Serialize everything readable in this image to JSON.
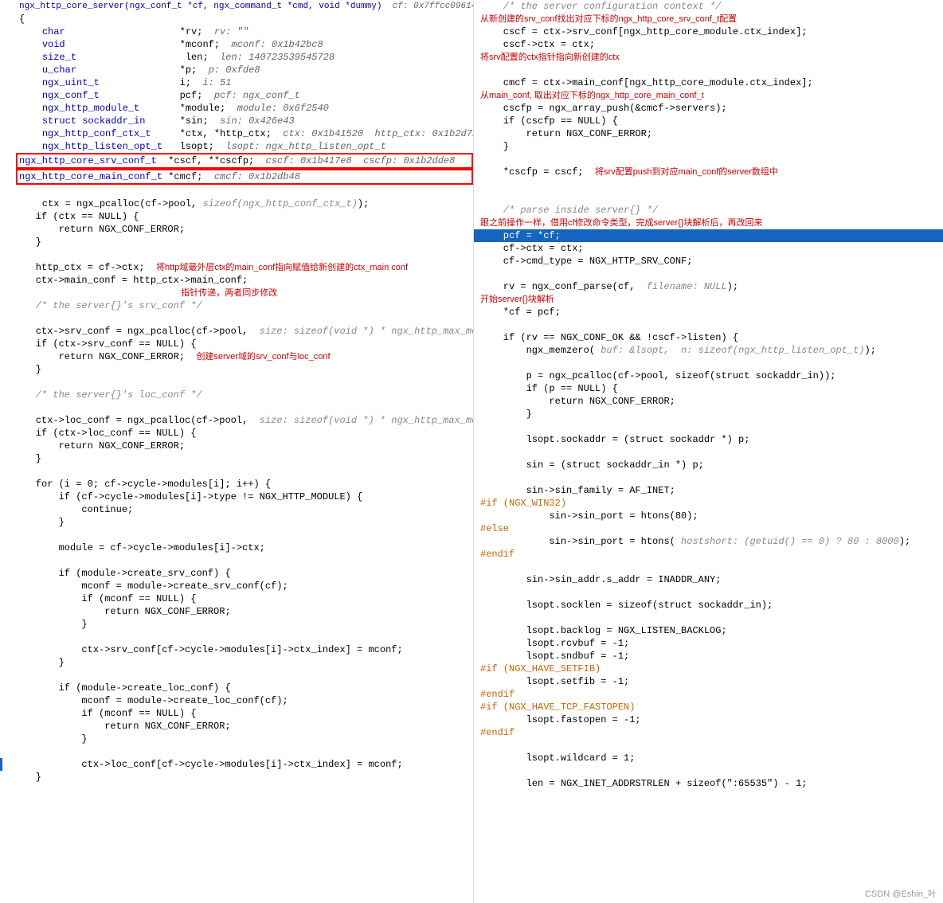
{
  "left": {
    "header": "ngx_http_core_server(ngx_conf_t *cf, ngx_command_t *cmd, void *dummy)  cf: 0x7ffcc096141",
    "lines": []
  },
  "right": {
    "lines": []
  },
  "watermark": "CSDN @Eshin_叶"
}
